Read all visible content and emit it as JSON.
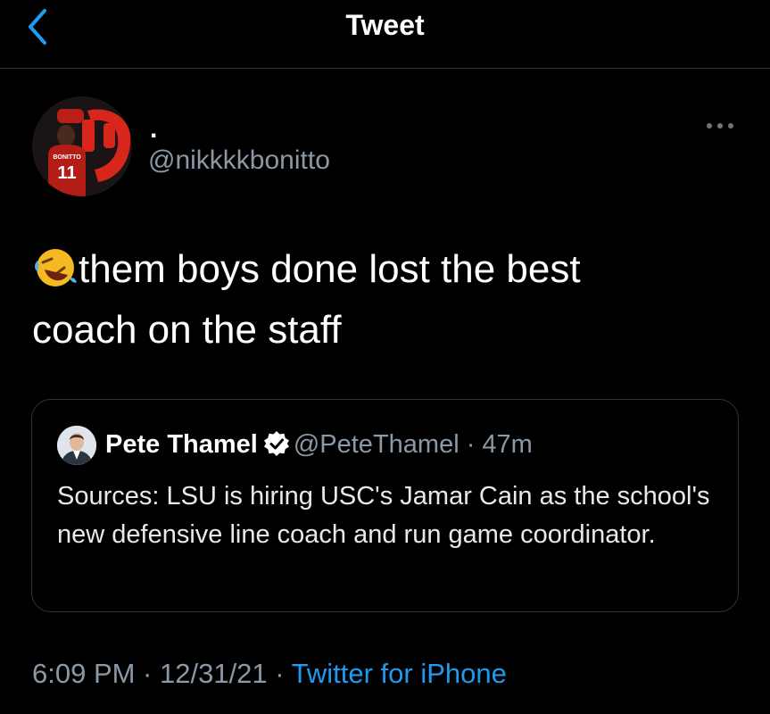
{
  "nav": {
    "title": "Tweet",
    "back_icon": "chevron-left-icon"
  },
  "tweet": {
    "author": {
      "display_name": ".",
      "handle": "@nikkkkbonitto",
      "avatar_jersey_name": "BONITTO",
      "avatar_jersey_number": "11"
    },
    "text_line1": "them boys done lost the best",
    "text_line2": "coach on the staff",
    "emoji": "rolling-on-floor-laughing-emoji",
    "timestamp": "6:09 PM · 12/31/21 · ",
    "source": "Twitter for iPhone"
  },
  "quoted": {
    "name": "Pete Thamel",
    "handle": "@PeteThamel",
    "time": " · 47m",
    "text": "Sources: LSU is hiring USC's Jamar Cain as the school's new defensive line coach and run game coordinator."
  },
  "colors": {
    "background": "#000000",
    "text": "#e7e9ea",
    "secondary_text": "#8b98a5",
    "accent": "#1d9bf0",
    "border": "#2f3336"
  }
}
